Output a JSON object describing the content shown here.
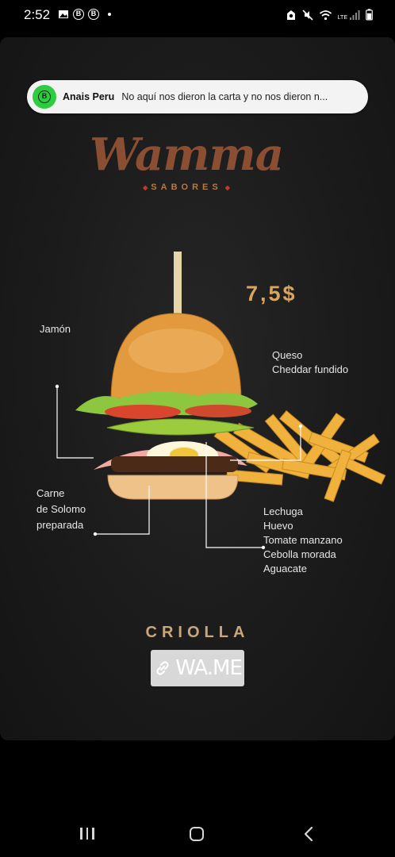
{
  "status_bar": {
    "time": "2:52",
    "left_icons": [
      "gallery-icon",
      "b-app-icon",
      "b-app-icon",
      "dot"
    ],
    "right_icons": [
      "alarm-icon",
      "mute-vibrate-icon",
      "wifi-icon",
      "lte-signal-icon",
      "battery-icon"
    ],
    "lte_label": "LTE"
  },
  "notification": {
    "avatar_letter": "B",
    "sender": "Anais Peru",
    "message": "No aquí nos dieron la carta y no nos dieron n..."
  },
  "story": {
    "brand_name": "Wamma",
    "brand_subtitle": "SABORES",
    "price": "7,5$",
    "labels": {
      "jamon": "Jamón",
      "queso_line1": "Queso",
      "queso_line2": "Cheddar fundido",
      "carne_line1": "Carne",
      "carne_line2": "de Solomo",
      "carne_line3": "preparada",
      "toppings": [
        "Lechuga",
        "Huevo",
        "Tomate manzano",
        "Cebolla morada",
        "Aguacate"
      ]
    },
    "product_name": "CRIOLLA",
    "link_sticker": "WA.ME"
  },
  "colors": {
    "brand": "#8a4f32",
    "price": "#d8a55f",
    "notification_avatar": "#2ecc40",
    "background": "#1b1b1b"
  }
}
